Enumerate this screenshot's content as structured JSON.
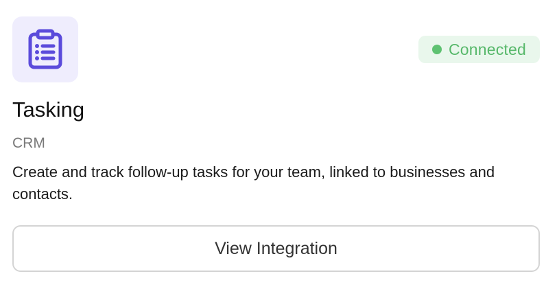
{
  "integration": {
    "icon": "clipboard-list-icon",
    "icon_color": "#5b4bdb",
    "icon_background": "#efedfd",
    "status": {
      "label": "Connected",
      "color": "#5ec271"
    },
    "name": "Tasking",
    "category": "CRM",
    "description": "Create and track follow-up tasks for your team, linked to businesses and contacts.",
    "action_label": "View Integration"
  }
}
